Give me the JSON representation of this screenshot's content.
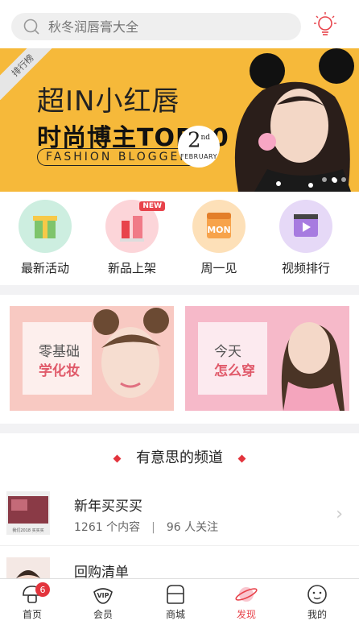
{
  "search": {
    "placeholder": "秋冬润唇膏大全"
  },
  "banner": {
    "ribbon": "排行榜",
    "title_line1": "超IN小红唇",
    "title_line2": "时尚博主TOP30",
    "title_line3": "FASHION BLOGGER",
    "date_day": "2",
    "date_sup": "nd",
    "date_month": "FEBRUARY",
    "accent_color": "#f6b93a"
  },
  "categories": [
    {
      "label": "最新活动",
      "icon": "gift-icon"
    },
    {
      "label": "新品上架",
      "icon": "lipstick-icon",
      "badge": "NEW"
    },
    {
      "label": "周一见",
      "icon": "calendar-icon",
      "icon_text": "MON"
    },
    {
      "label": "视频排行",
      "icon": "video-icon"
    }
  ],
  "promos": [
    {
      "line1": "零基础",
      "line2": "学化妆"
    },
    {
      "line1": "今天",
      "line2": "怎么穿"
    }
  ],
  "channels": {
    "title": "有意思的频道",
    "items": [
      {
        "name": "新年买买买",
        "count": "1261 个内容",
        "followers": "96 人关注",
        "thumb_text": "我们2018 买买买"
      },
      {
        "name": "回购清单",
        "count": "",
        "followers": ""
      }
    ]
  },
  "tabbar": {
    "items": [
      {
        "label": "首页",
        "badge": "6"
      },
      {
        "label": "会员"
      },
      {
        "label": "商城"
      },
      {
        "label": "发现",
        "active": true
      },
      {
        "label": "我的"
      }
    ],
    "active_color": "#e8434b"
  }
}
